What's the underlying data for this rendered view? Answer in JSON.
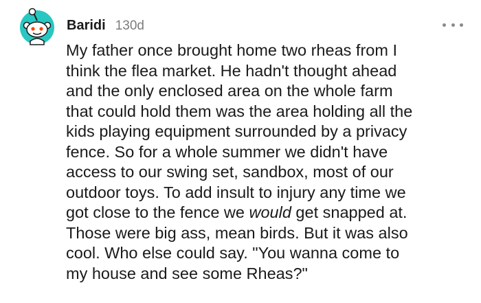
{
  "comment": {
    "username": "Baridi",
    "timestamp": "130d",
    "avatar_icon": "reddit-snoo-avatar-icon",
    "more_icon": "more-options-icon",
    "colors": {
      "avatar_bg": "#29c7c1",
      "text": "#1a1a1b",
      "meta": "#7c7c7c"
    },
    "body_lines": [
      "My father once brought home two rheas from I",
      "think the flea market. He hadn't thought ahead",
      "and the only enclosed area on the whole farm",
      "that could hold them was the area holding all the",
      "kids playing equipment surrounded by a privacy",
      "fence. So for a whole summer we didn't have",
      "access to our swing set, sandbox, most of our",
      "outdoor toys. To add insult to injury any time we"
    ],
    "line9": {
      "before": "got close to the fence we ",
      "emphasis": "would",
      "after": " get snapped at."
    },
    "body_lines_end": [
      "Those were big ass, mean birds. But it was also",
      "cool. Who else could say. \"You wanna come to",
      "my house and see some Rheas?\""
    ]
  }
}
